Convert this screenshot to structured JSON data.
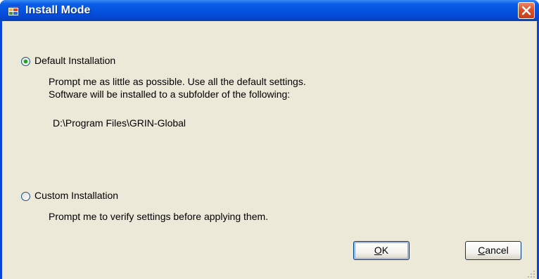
{
  "window": {
    "title": "Install Mode",
    "icon": "installer-app-icon"
  },
  "options": {
    "default": {
      "label": "Default Installation",
      "selected": true,
      "description_line1": "Prompt me as little as possible.  Use all the default settings.",
      "description_line2": "Software will be installed to a subfolder of the following:",
      "path": "D:\\Program Files\\GRIN-Global"
    },
    "custom": {
      "label": "Custom Installation",
      "selected": false,
      "description": "Prompt me to verify settings before applying them."
    }
  },
  "buttons": {
    "ok": "OK",
    "cancel": "Cancel"
  },
  "colors": {
    "titlebar": "#0553e0",
    "dialog_background": "#ece9d8",
    "close_button": "#d9512b",
    "radio_selected": "#21a121"
  }
}
